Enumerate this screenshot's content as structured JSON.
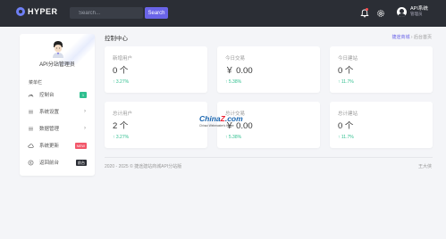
{
  "brand": {
    "name": "HYPER"
  },
  "search": {
    "placeholder": "Search...",
    "button_label": "Search"
  },
  "user": {
    "name": "API系统",
    "role": "管理员"
  },
  "sidebar": {
    "profile_title": "API分站管理员",
    "section_label": "菜单栏",
    "items": [
      {
        "label": "控制台",
        "icon": "dashboard-icon",
        "badge": "1",
        "badge_color": "#2fbf8f"
      },
      {
        "label": "系统设置",
        "icon": "settings-list-icon",
        "chevron": "›"
      },
      {
        "label": "数据管理",
        "icon": "data-list-icon",
        "chevron": "›"
      },
      {
        "label": "系统更新",
        "icon": "cloud-icon",
        "badge": "NEW",
        "badge_color": "#f2576a"
      },
      {
        "label": "返回前台",
        "icon": "return-icon",
        "badge": "前台",
        "badge_color": "#2b2e35"
      }
    ]
  },
  "main": {
    "title": "控制中心",
    "breadcrumb": {
      "link": "捷途商城",
      "separator": "›",
      "current": "后台首页"
    }
  },
  "cards": [
    {
      "label": "新增用户",
      "value": "0 个",
      "trend": "3.27%"
    },
    {
      "label": "今日交易",
      "value": "￥ 0.00",
      "trend": "5.38%"
    },
    {
      "label": "今日建站",
      "value": "0 个",
      "trend": "11.7%"
    },
    {
      "label": "总计用户",
      "value": "2 个",
      "trend": "3.27%"
    },
    {
      "label": "总计交易",
      "value": "￥ 0.00",
      "trend": "5.38%"
    },
    {
      "label": "总计建站",
      "value": "0 个",
      "trend": "11.7%"
    }
  ],
  "trend_arrow": "↑",
  "footer": {
    "copyright": "2020 - 2025 © 捷途建站商城API分站版",
    "right": "王大侠"
  },
  "watermark": {
    "main_prefix": "China",
    "main_accent": "Z",
    "main_suffix": ".com",
    "sub": "Chinaz Webmaster's Home"
  }
}
